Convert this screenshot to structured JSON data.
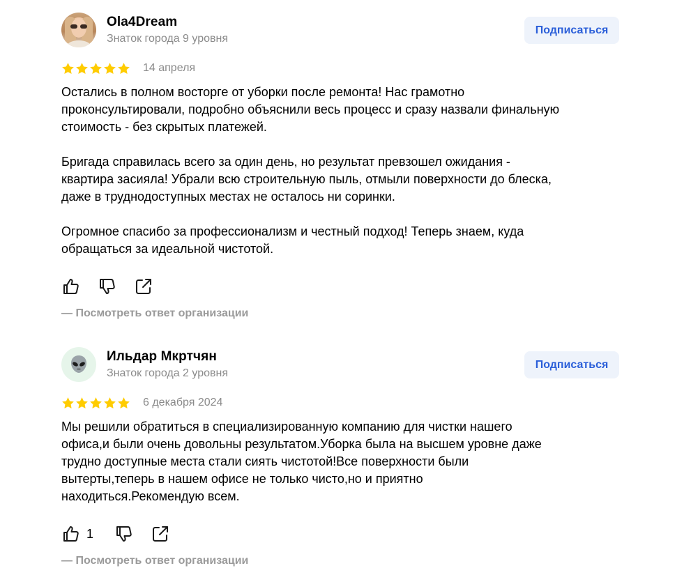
{
  "colors": {
    "star": "#ffcc00",
    "subscribe_bg": "#eef3fb",
    "subscribe_text": "#2b5fd9",
    "muted": "#8a8a8a"
  },
  "reviews": [
    {
      "author": "Ola4Dream",
      "badge": "Знаток города 9 уровня",
      "avatar": "user-photo",
      "subscribe_label": "Подписаться",
      "rating": 5,
      "date": "14 апреля",
      "text": "Остались в полном восторге от уборки после ремонта! Нас грамотно\nпроконсультировали, подробно объяснили весь процесс и сразу назвали финальную\nстоимость - без скрытых платежей.\n\nБригада справилась всего за один день, но результат превзошел ожидания -\nквартира засияла! Убрали всю строительную пыль, отмыли поверхности до блеска,\nдаже в труднодоступных местах не осталось ни соринки.\n\nОгромное спасибо за профессионализм и честный подход! Теперь знаем, куда\nобращаться за идеальной чистотой.",
      "likes": "",
      "answer_link": "— Посмотреть ответ организации"
    },
    {
      "author": "Ильдар Мкртчян",
      "badge": "Знаток города 2 уровня",
      "avatar": "alien-emoji-icon",
      "subscribe_label": "Подписаться",
      "rating": 5,
      "date": "6 декабря 2024",
      "text": "Мы решили обратиться в специализированную компанию для чистки нашего\nофиса,и были очень довольны результатом.Уборка была на высшем уровне даже\nтрудно доступные места стали сиять чистотой!Все поверхности были\nвытерты,теперь в нашем офисе не только чисто,но и приятно\nнаходиться.Рекомендую всем.",
      "likes": "1",
      "answer_link": "— Посмотреть ответ организации"
    }
  ]
}
